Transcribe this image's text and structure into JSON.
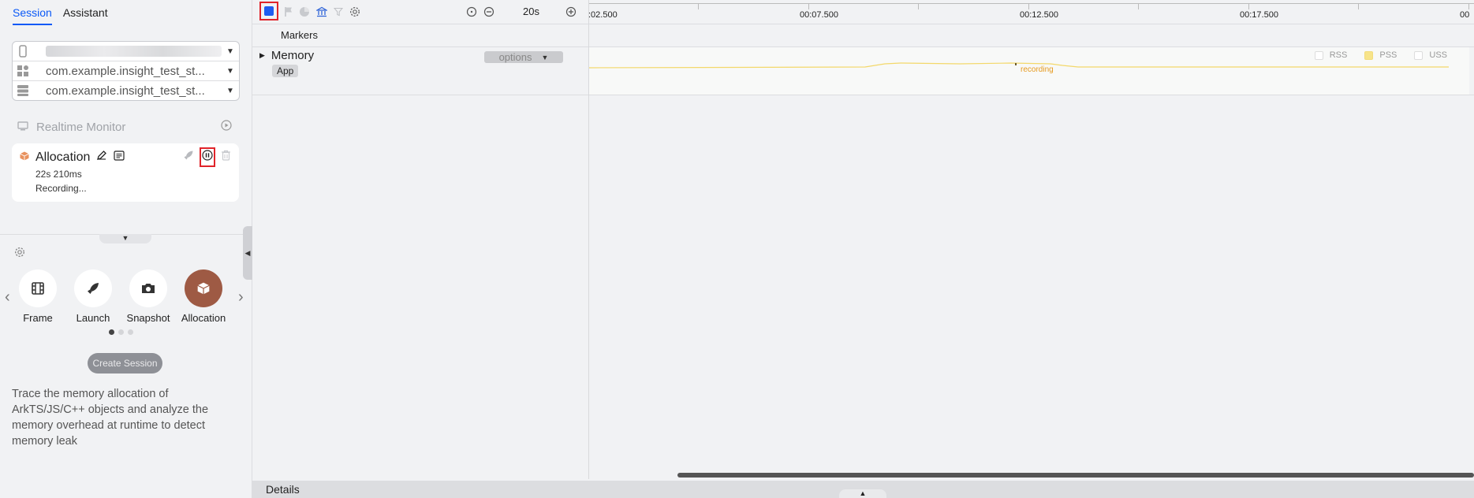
{
  "tabs": [
    "Session",
    "Assistant"
  ],
  "device_selectors": [
    {
      "icon": "phone-icon",
      "value": ""
    },
    {
      "icon": "apps-icon",
      "value": "com.example.insight_test_st..."
    },
    {
      "icon": "process-icon",
      "value": "com.example.insight_test_st..."
    }
  ],
  "realtime_monitor": {
    "label": "Realtime Monitor"
  },
  "allocation_card": {
    "title": "Allocation",
    "duration": "22s 210ms",
    "status": "Recording..."
  },
  "tools": [
    {
      "label": "Frame",
      "icon": "frame-icon",
      "selected": false
    },
    {
      "label": "Launch",
      "icon": "rocket-icon",
      "selected": false
    },
    {
      "label": "Snapshot",
      "icon": "camera-icon",
      "selected": false
    },
    {
      "label": "Allocation",
      "icon": "cube-icon",
      "selected": true
    }
  ],
  "carousel": {
    "pages": 3,
    "current": 1
  },
  "create_session_label": "Create Session",
  "description": "Trace the memory allocation of ArkTS/JS/C++ objects and analyze the memory overhead at runtime to detect memory leak",
  "toolbar": {
    "zoom_label": "20s"
  },
  "timeline": {
    "ticks": [
      ":02.500",
      "00:07.500",
      "00:12.500",
      "00:17.500",
      "00"
    ]
  },
  "markers_label": "Markers",
  "track": {
    "name": "Memory",
    "badge": "App",
    "options_label": "options",
    "legend": [
      "RSS",
      "PSS",
      "USS"
    ],
    "recording_label": "recording",
    "line_color": "#f3d86a"
  },
  "details_label": "Details",
  "colors": {
    "accent": "#0a59f7",
    "record": "#1f5cf0",
    "allocation": "#9e5a44",
    "highlight": "#e0242a"
  }
}
